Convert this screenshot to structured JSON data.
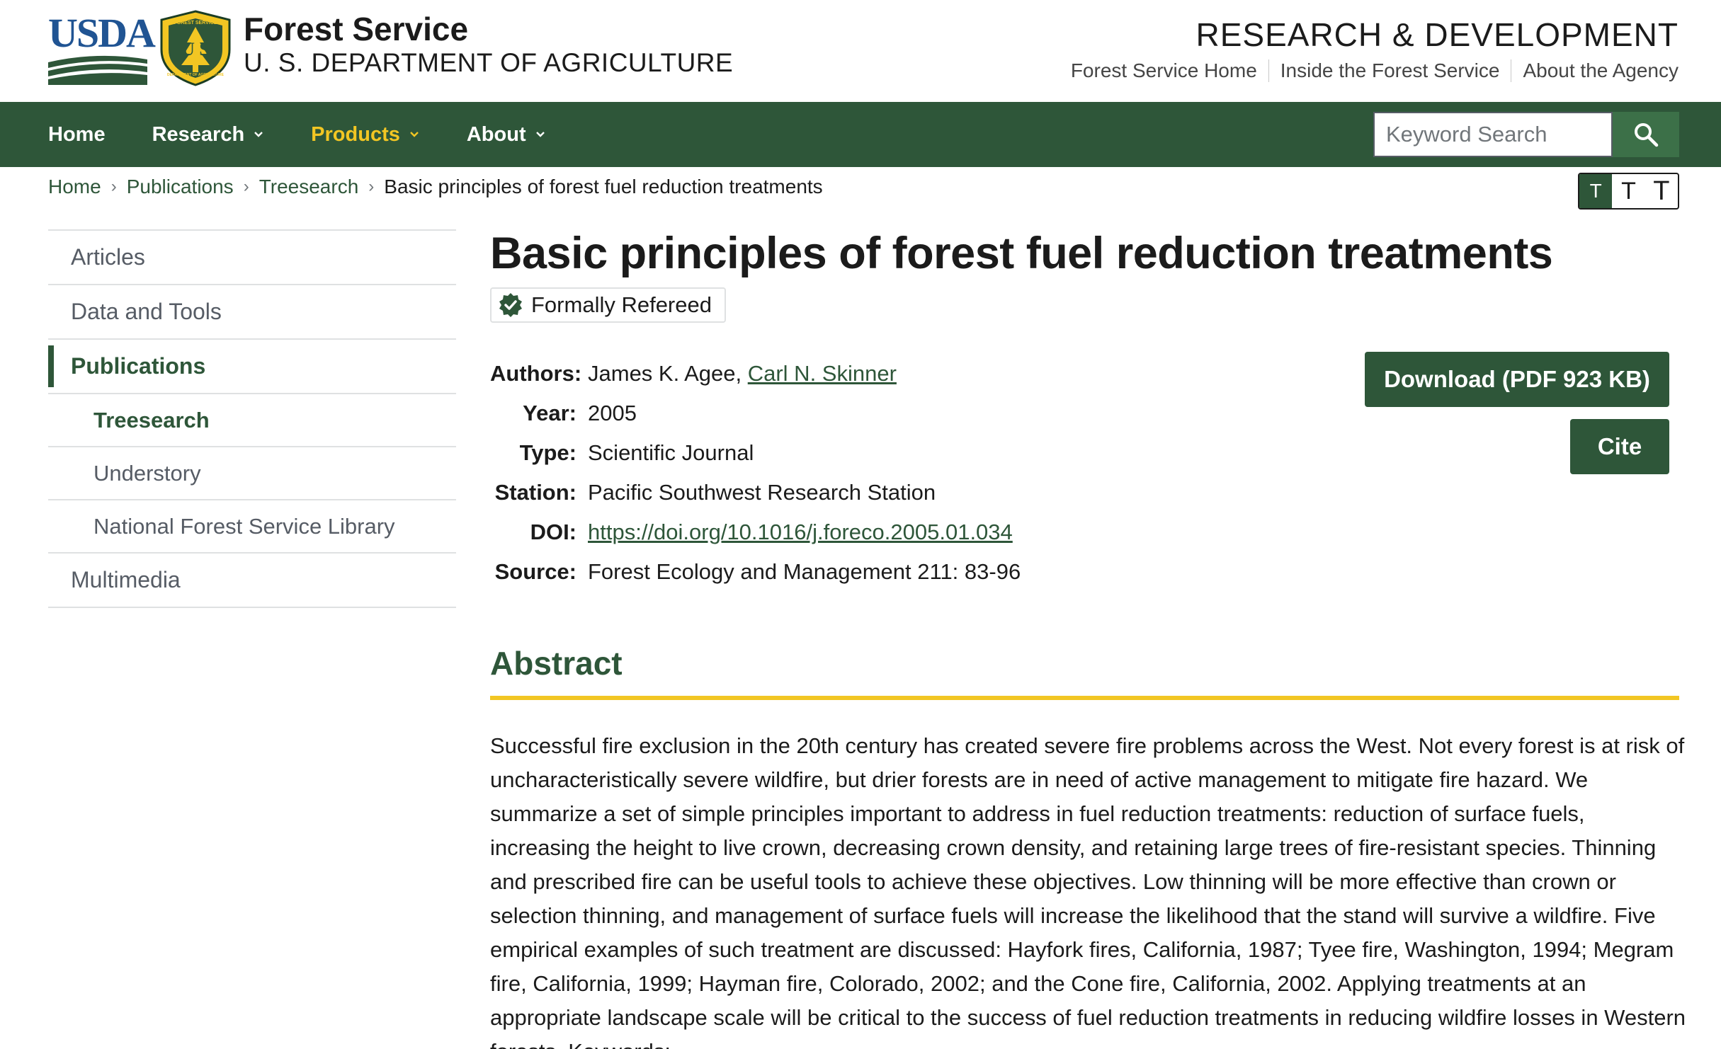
{
  "header": {
    "usda_logo": "USDA",
    "shield_emblem": "U S",
    "shield_ring_text": "FOREST SERVICE",
    "shield_ring_bottom": "DEPARTMENT OF AGRICULTURE",
    "agency_name": "Forest Service",
    "agency_dept": "U. S. DEPARTMENT OF AGRICULTURE",
    "section_title": "RESEARCH & DEVELOPMENT",
    "utility_links": [
      "Forest Service Home",
      "Inside the Forest Service",
      "About the Agency"
    ]
  },
  "nav": {
    "items": [
      {
        "label": "Home",
        "dropdown": false,
        "active": false
      },
      {
        "label": "Research",
        "dropdown": true,
        "active": false
      },
      {
        "label": "Products",
        "dropdown": true,
        "active": true
      },
      {
        "label": "About",
        "dropdown": true,
        "active": false
      }
    ],
    "search_placeholder": "Keyword Search",
    "search_icon": "search-icon",
    "colors": {
      "bar": "#2e5639",
      "active": "#f2c623"
    }
  },
  "breadcrumb": {
    "items": [
      "Home",
      "Publications",
      "Treesearch"
    ],
    "current": "Basic principles of forest fuel reduction treatments"
  },
  "text_size": {
    "options": [
      "T",
      "T",
      "T"
    ],
    "selected": 0
  },
  "sidebar": {
    "items": [
      {
        "label": "Articles",
        "level": 0,
        "current": false
      },
      {
        "label": "Data and Tools",
        "level": 0,
        "current": false
      },
      {
        "label": "Publications",
        "level": 0,
        "current": true
      },
      {
        "label": "Treesearch",
        "level": 1,
        "current": true
      },
      {
        "label": "Understory",
        "level": 1,
        "current": false
      },
      {
        "label": "National Forest Service Library",
        "level": 1,
        "current": false
      },
      {
        "label": "Multimedia",
        "level": 0,
        "current": false
      }
    ]
  },
  "publication": {
    "title": "Basic principles of forest fuel reduction treatments",
    "badge": "Formally Refereed",
    "badge_icon": "verified-check-icon",
    "labels": {
      "authors": "Authors:",
      "year": "Year:",
      "type": "Type:",
      "station": "Station:",
      "doi": "DOI:",
      "source": "Source:"
    },
    "authors_plain": "James K. Agee, ",
    "authors_link": "Carl N. Skinner",
    "year": "2005",
    "type": "Scientific Journal",
    "station": "Pacific Southwest Research Station",
    "doi": "https://doi.org/10.1016/j.foreco.2005.01.034",
    "source": "Forest Ecology and Management 211: 83-96",
    "download_label": "Download (PDF 923 KB)",
    "cite_label": "Cite"
  },
  "abstract": {
    "heading": "Abstract",
    "text": "Successful fire exclusion in the 20th century has created severe fire problems across the West. Not every forest is at risk of uncharacteristically severe wildfire, but drier forests are in need of active management to mitigate fire hazard. We summarize a set of simple principles important to address in fuel reduction treatments: reduction of surface fuels, increasing the height to live crown, decreasing crown density, and retaining large trees of fire-resistant species. Thinning and prescribed fire can be useful tools to achieve these objectives. Low thinning will be more effective than crown or selection thinning, and management of surface fuels will increase the likelihood that the stand will survive a wildfire. Five empirical examples of such treatment are discussed: Hayfork fires, California, 1987; Tyee fire, Washington, 1994; Megram fire, California, 1999; Hayman fire, Colorado, 2002; and the Cone fire, California, 2002. Applying treatments at an appropriate landscape scale will be critical to the success of fuel reduction treatments in reducing wildfire losses in Western forests. Keywords:"
  }
}
